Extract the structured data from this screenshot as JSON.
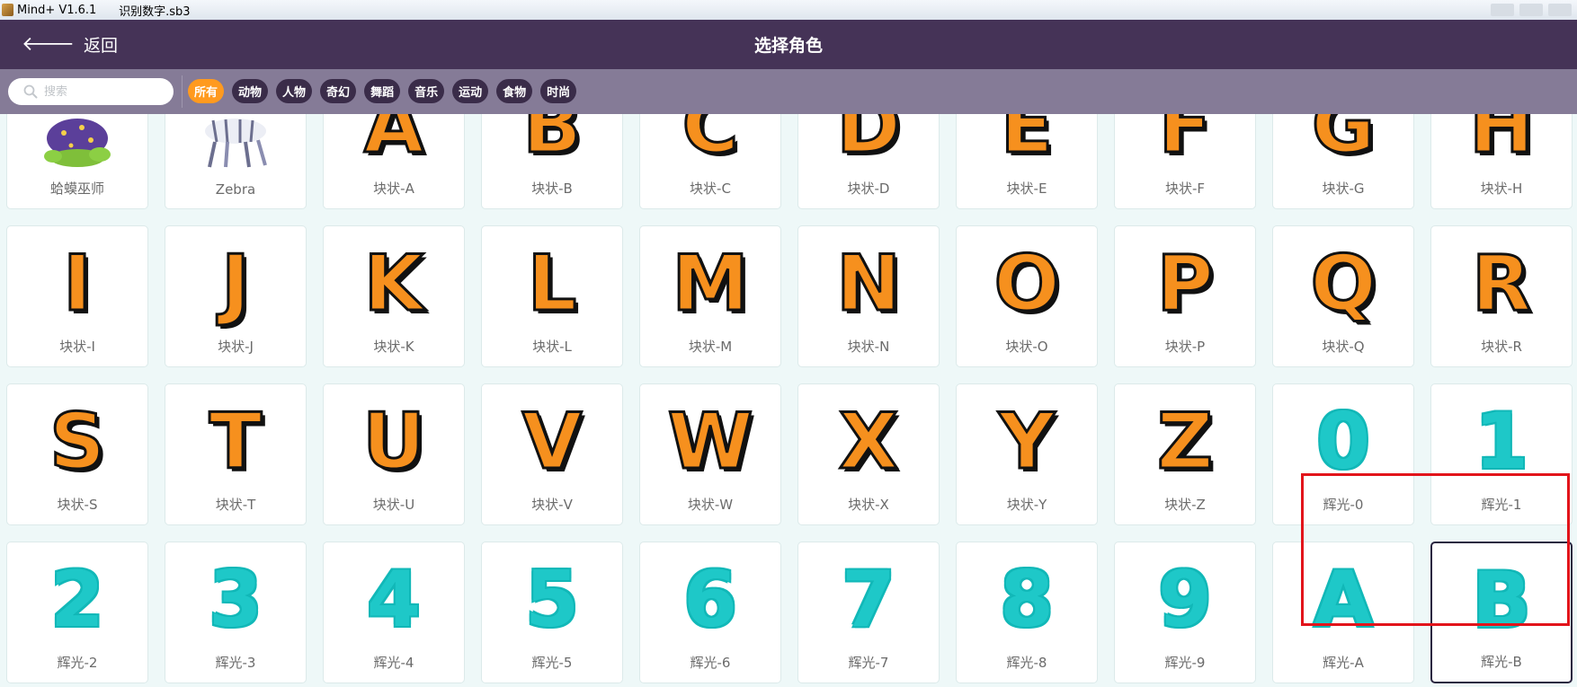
{
  "window": {
    "app_title": "Mind+ V1.6.1",
    "file_name": "识别数字.sb3"
  },
  "header": {
    "back_label": "返回",
    "title": "选择角色"
  },
  "search": {
    "placeholder": "搜索"
  },
  "tags": [
    {
      "label": "所有",
      "active": true
    },
    {
      "label": "动物",
      "active": false
    },
    {
      "label": "人物",
      "active": false
    },
    {
      "label": "奇幻",
      "active": false
    },
    {
      "label": "舞蹈",
      "active": false
    },
    {
      "label": "音乐",
      "active": false
    },
    {
      "label": "运动",
      "active": false
    },
    {
      "label": "食物",
      "active": false
    },
    {
      "label": "时尚",
      "active": false
    }
  ],
  "colors": {
    "header": "#453357",
    "filterbar": "#857b97",
    "tag_active": "#ff9a1f",
    "block_letter": "#f6901e",
    "glow_letter": "#1ec8c8",
    "highlight": "#e2141b"
  },
  "sprites": [
    {
      "label": "蛤蟆巫师",
      "kind": "toad-wizard",
      "glyph": ""
    },
    {
      "label": "Zebra",
      "kind": "zebra",
      "glyph": ""
    },
    {
      "label": "块状-A",
      "kind": "block",
      "glyph": "A"
    },
    {
      "label": "块状-B",
      "kind": "block",
      "glyph": "B"
    },
    {
      "label": "块状-C",
      "kind": "block",
      "glyph": "C"
    },
    {
      "label": "块状-D",
      "kind": "block",
      "glyph": "D"
    },
    {
      "label": "块状-E",
      "kind": "block",
      "glyph": "E"
    },
    {
      "label": "块状-F",
      "kind": "block",
      "glyph": "F"
    },
    {
      "label": "块状-G",
      "kind": "block",
      "glyph": "G"
    },
    {
      "label": "块状-H",
      "kind": "block",
      "glyph": "H"
    },
    {
      "label": "块状-I",
      "kind": "block",
      "glyph": "I"
    },
    {
      "label": "块状-J",
      "kind": "block",
      "glyph": "J"
    },
    {
      "label": "块状-K",
      "kind": "block",
      "glyph": "K"
    },
    {
      "label": "块状-L",
      "kind": "block",
      "glyph": "L"
    },
    {
      "label": "块状-M",
      "kind": "block",
      "glyph": "M"
    },
    {
      "label": "块状-N",
      "kind": "block",
      "glyph": "N"
    },
    {
      "label": "块状-O",
      "kind": "block",
      "glyph": "O"
    },
    {
      "label": "块状-P",
      "kind": "block",
      "glyph": "P"
    },
    {
      "label": "块状-Q",
      "kind": "block",
      "glyph": "Q"
    },
    {
      "label": "块状-R",
      "kind": "block",
      "glyph": "R"
    },
    {
      "label": "块状-S",
      "kind": "block",
      "glyph": "S"
    },
    {
      "label": "块状-T",
      "kind": "block",
      "glyph": "T"
    },
    {
      "label": "块状-U",
      "kind": "block",
      "glyph": "U"
    },
    {
      "label": "块状-V",
      "kind": "block",
      "glyph": "V"
    },
    {
      "label": "块状-W",
      "kind": "block",
      "glyph": "W"
    },
    {
      "label": "块状-X",
      "kind": "block",
      "glyph": "X"
    },
    {
      "label": "块状-Y",
      "kind": "block",
      "glyph": "Y"
    },
    {
      "label": "块状-Z",
      "kind": "block",
      "glyph": "Z"
    },
    {
      "label": "辉光-0",
      "kind": "glow",
      "glyph": "0"
    },
    {
      "label": "辉光-1",
      "kind": "glow",
      "glyph": "1"
    },
    {
      "label": "辉光-2",
      "kind": "glow",
      "glyph": "2"
    },
    {
      "label": "辉光-3",
      "kind": "glow",
      "glyph": "3"
    },
    {
      "label": "辉光-4",
      "kind": "glow",
      "glyph": "4"
    },
    {
      "label": "辉光-5",
      "kind": "glow",
      "glyph": "5"
    },
    {
      "label": "辉光-6",
      "kind": "glow",
      "glyph": "6"
    },
    {
      "label": "辉光-7",
      "kind": "glow",
      "glyph": "7"
    },
    {
      "label": "辉光-8",
      "kind": "glow",
      "glyph": "8"
    },
    {
      "label": "辉光-9",
      "kind": "glow",
      "glyph": "9"
    },
    {
      "label": "辉光-A",
      "kind": "glow",
      "glyph": "A"
    },
    {
      "label": "辉光-B",
      "kind": "glow",
      "glyph": "B",
      "selected": true
    }
  ]
}
